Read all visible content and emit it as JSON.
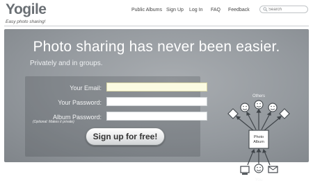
{
  "header": {
    "logo": "Yogile",
    "tagline": "Easy photo sharing!",
    "nav": [
      "Public Albums",
      "Sign Up",
      "Log In",
      "FAQ",
      "Feedback"
    ],
    "search_placeholder": "Search"
  },
  "hero": {
    "title": "Photo sharing has never been easier.",
    "subtitle": "Privately and in groups.",
    "form": {
      "email_label": "Your Email:",
      "email_value": "",
      "password_label": "Your Password:",
      "password_value": "",
      "album_password_label": "Album Password:",
      "album_password_value": "",
      "optional_note": "(Optional: Makes it private)",
      "submit_label": "Sign up for free!"
    },
    "diagram": {
      "others_label": "Others",
      "album_label_line1": "Photo",
      "album_label_line2": "Album",
      "you_label": "You",
      "icons": [
        "diamond-icon",
        "smiley-icon",
        "smiley-icon",
        "smiley-icon",
        "diamond-icon",
        "computer-icon",
        "envelope-icon"
      ]
    }
  },
  "colors": {
    "hero_background": "#94999e",
    "focused_input": "#fbfbe2",
    "text_light": "#ffffff"
  }
}
